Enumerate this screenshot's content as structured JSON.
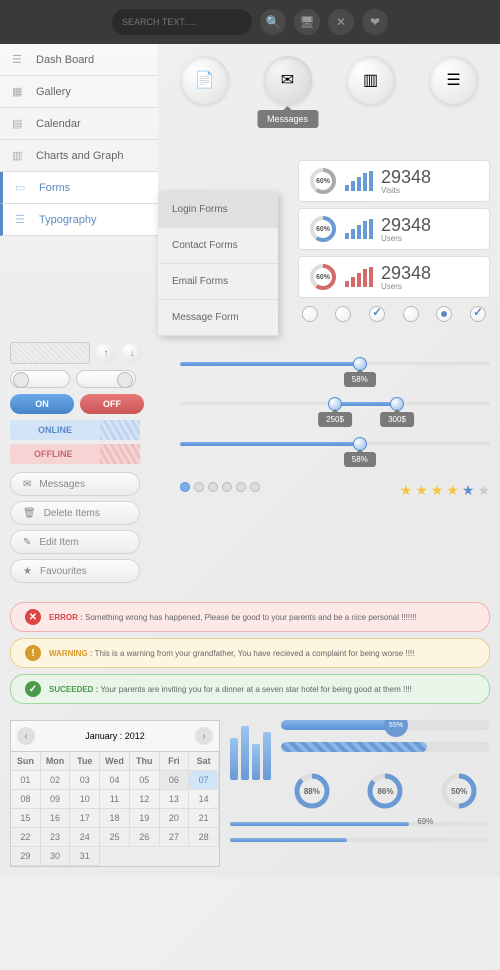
{
  "search": {
    "placeholder": "SEARCH TEXT....."
  },
  "sidebar": {
    "items": [
      {
        "label": "Dash Board"
      },
      {
        "label": "Gallery"
      },
      {
        "label": "Calendar"
      },
      {
        "label": "Charts and Graph"
      },
      {
        "label": "Forms"
      },
      {
        "label": "Typography"
      }
    ]
  },
  "circles": {
    "tooltip": "Messages"
  },
  "submenu": {
    "items": [
      {
        "label": "Login Forms"
      },
      {
        "label": "Contact Forms"
      },
      {
        "label": "Email Forms"
      },
      {
        "label": "Message Form"
      }
    ]
  },
  "stats": [
    {
      "pct": "60%",
      "value": "29348",
      "label": "Visits",
      "color": "#aaa"
    },
    {
      "pct": "60%",
      "value": "29348",
      "label": "Users",
      "color": "#6a9ad4"
    },
    {
      "pct": "60%",
      "value": "29348",
      "label": "Users",
      "color": "#d46a6a"
    }
  ],
  "toggles": {
    "on": "ON",
    "off": "OFF",
    "online": "ONLINE",
    "offline": "OFFLINE"
  },
  "pillbtns": [
    {
      "label": "Messages"
    },
    {
      "label": "Delete Items"
    },
    {
      "label": "Edit Item"
    },
    {
      "label": "Favourites"
    }
  ],
  "sliders": [
    {
      "pct": 58,
      "label": "58%"
    },
    {
      "pct": 50,
      "labels": [
        "250$",
        "300$"
      ],
      "pct2": 70
    },
    {
      "pct": 58,
      "label": "58%"
    }
  ],
  "alerts": {
    "error": {
      "title": "ERROR :",
      "msg": "Something wrong has happened, Please be good to your parents and be a nice personal !!!!!!!"
    },
    "warn": {
      "title": "WARNING :",
      "msg": "This is a warning from your grandfather, You have recieved a complaint for being worse !!!!"
    },
    "success": {
      "title": "SUCEEDED :",
      "msg": "Your parents are inviting you for a dinner at a seven star hotel for being good at them !!!!"
    }
  },
  "calendar": {
    "title": "January : 2012",
    "days": [
      "Sun",
      "Mon",
      "Tue",
      "Wed",
      "Thu",
      "Fri",
      "Sat"
    ],
    "dates": [
      "01",
      "02",
      "03",
      "04",
      "05",
      "06",
      "07",
      "08",
      "09",
      "10",
      "11",
      "12",
      "13",
      "14",
      "15",
      "16",
      "17",
      "18",
      "19",
      "20",
      "21",
      "22",
      "23",
      "24",
      "25",
      "26",
      "27",
      "28",
      "29",
      "30",
      "31"
    ],
    "selected": "06",
    "today": "07"
  },
  "progress": {
    "bars": [
      {
        "pct": 55,
        "label": "55%"
      },
      {
        "pct": 70
      }
    ],
    "rings": [
      {
        "pct": 88,
        "label": "88%"
      },
      {
        "pct": 86,
        "label": "86%"
      },
      {
        "pct": 50,
        "label": "50%"
      }
    ],
    "lines": [
      {
        "pct": 69,
        "label": "69%"
      },
      {
        "pct": 45,
        "label": ""
      }
    ]
  }
}
